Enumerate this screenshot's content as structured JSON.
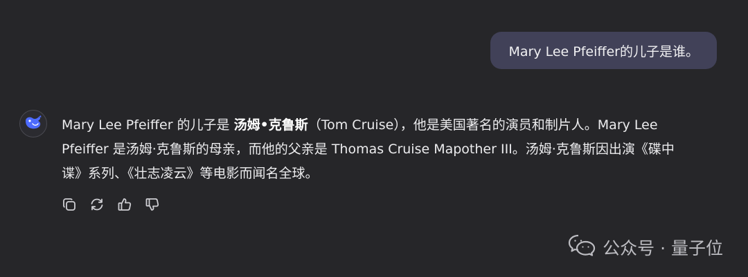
{
  "user_message": {
    "text": "Mary Lee Pfeiffer的儿子是谁。"
  },
  "assistant": {
    "avatar_icon": "whale-logo-icon",
    "brand_color": "#4d6bfe",
    "lines": {
      "l1_pre": "Mary Lee Pfeiffer 的儿子是 ",
      "l1_bold": "汤姆•克鲁斯",
      "l1_post": "（Tom Cruise），他是美国著名的演员和制片人。Mary Lee",
      "l2": "Pfeiffer 是汤姆·克鲁斯的母亲，而他的父亲是 Thomas Cruise Mapother III。汤姆·克鲁斯因出演《碟中",
      "l3": "谍》系列、《壮志凌云》等电影而闻名全球。"
    }
  },
  "actions": [
    {
      "icon": "copy-icon"
    },
    {
      "icon": "regenerate-icon"
    },
    {
      "icon": "thumbs-up-icon"
    },
    {
      "icon": "thumbs-down-icon"
    }
  ],
  "watermark": {
    "icon": "wechat-icon",
    "text": "公众号 · 量子位"
  }
}
